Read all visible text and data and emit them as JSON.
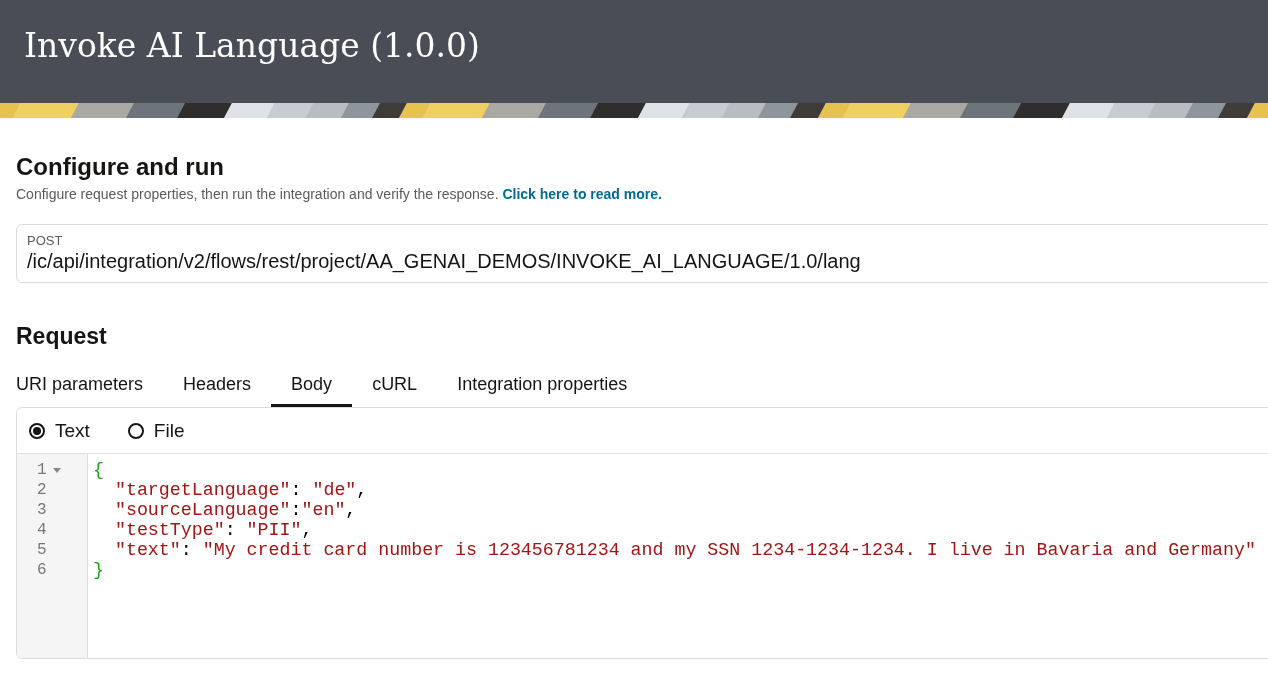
{
  "header": {
    "title": "Invoke AI Language (1.0.0)"
  },
  "configure": {
    "heading": "Configure and run",
    "description": "Configure request properties, then run the integration and verify the response.",
    "link": "Click here to read more."
  },
  "endpoint": {
    "method": "POST",
    "path": "/ic/api/integration/v2/flows/rest/project/AA_GENAI_DEMOS/INVOKE_AI_LANGUAGE/1.0/lang"
  },
  "request": {
    "heading": "Request",
    "tabs": [
      {
        "label": "URI parameters",
        "selected": false
      },
      {
        "label": "Headers",
        "selected": false
      },
      {
        "label": "Body",
        "selected": true
      },
      {
        "label": "cURL",
        "selected": false
      },
      {
        "label": "Integration properties",
        "selected": false
      }
    ],
    "body_modes": [
      {
        "label": "Text",
        "selected": true
      },
      {
        "label": "File",
        "selected": false
      }
    ],
    "editor": {
      "lines": [
        {
          "number": "1",
          "foldable": true,
          "tokens": [
            {
              "kind": "brace",
              "text": "{"
            }
          ]
        },
        {
          "number": "2",
          "foldable": false,
          "tokens": [
            {
              "kind": "string",
              "text": "  \"targetLanguage\""
            },
            {
              "kind": "punct",
              "text": ": "
            },
            {
              "kind": "string",
              "text": "\"de\""
            },
            {
              "kind": "punct",
              "text": ","
            }
          ]
        },
        {
          "number": "3",
          "foldable": false,
          "tokens": [
            {
              "kind": "string",
              "text": "  \"sourceLanguage\""
            },
            {
              "kind": "punct",
              "text": ":"
            },
            {
              "kind": "string",
              "text": "\"en\""
            },
            {
              "kind": "punct",
              "text": ","
            }
          ]
        },
        {
          "number": "4",
          "foldable": false,
          "tokens": [
            {
              "kind": "string",
              "text": "  \"testType\""
            },
            {
              "kind": "punct",
              "text": ": "
            },
            {
              "kind": "string",
              "text": "\"PII\""
            },
            {
              "kind": "punct",
              "text": ","
            }
          ]
        },
        {
          "number": "5",
          "foldable": false,
          "tokens": [
            {
              "kind": "string",
              "text": "  \"text\""
            },
            {
              "kind": "punct",
              "text": ": "
            },
            {
              "kind": "string",
              "text": "\"My credit card number is 123456781234 and my SSN 1234-1234-1234. I live in Bavaria and Germany\""
            }
          ]
        },
        {
          "number": "6",
          "foldable": false,
          "tokens": [
            {
              "kind": "brace",
              "text": "}"
            }
          ]
        }
      ]
    }
  }
}
